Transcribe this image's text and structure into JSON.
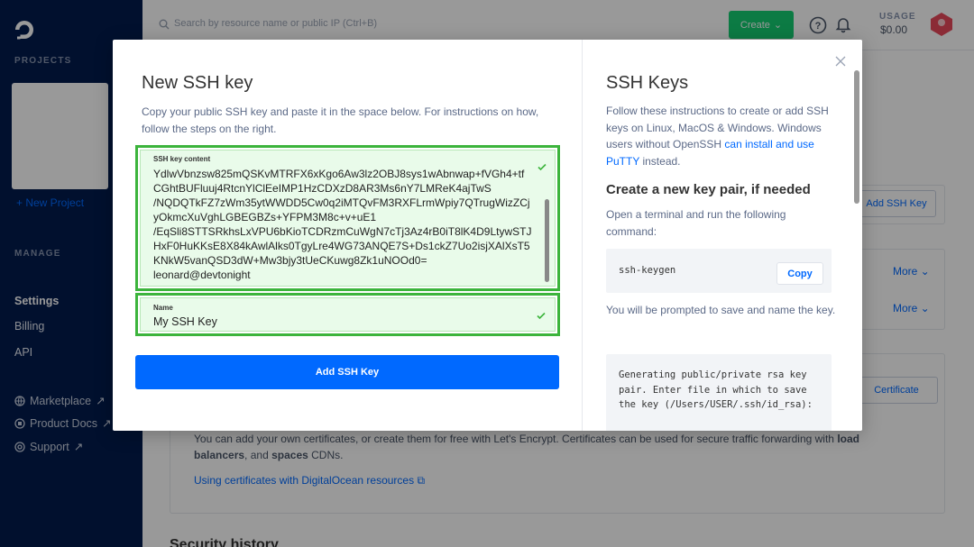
{
  "app": {
    "search_placeholder": "Search by resource name or public IP (Ctrl+B)",
    "create_label": "Create",
    "usage_label": "USAGE",
    "usage_value": "$0.00"
  },
  "sidebar": {
    "projects_label": "PROJECTS",
    "new_project_label": "New Project",
    "manage_label": "MANAGE",
    "items": [
      {
        "label": "Settings"
      },
      {
        "label": "Billing"
      },
      {
        "label": "API"
      }
    ],
    "external": [
      {
        "label": "Marketplace"
      },
      {
        "label": "Product Docs"
      },
      {
        "label": "Support"
      }
    ]
  },
  "background": {
    "add_ssh_key_label": "Add SSH Key",
    "more_label_1": "More",
    "more_label_2": "More",
    "certificate_label": "Certificate",
    "cert_text_1": "You can add your own certificates, or create them for free with Let's Encrypt. Certificates can be used for secure traffic forwarding with",
    "cert_text_bold_1": "load balancers",
    "cert_text_2": ", and",
    "cert_text_bold_2": "spaces",
    "cert_text_3": "CDNs.",
    "cert_link": "Using certificates with DigitalOcean resources",
    "security_heading": "Security history"
  },
  "modal": {
    "title": "New SSH key",
    "description": "Copy your public SSH key and paste it in the space below. For instructions on how, follow the steps on the right.",
    "ssh_field": {
      "label": "SSH key content",
      "value": "YdlwVbnzsw825mQSKvMTRFX6xKgo6Aw3lz2OBJ8sys1wAbnwap+fVGh4+tf\nCGhtBUFluuj4RtcnYlClEeIMP1HzCDXzD8AR3Ms6nY7LMReK4ajTwS\n/NQDQTkFZ7zWm35ytWWDD5Cw0q2iMTQvFM3RXFLrmWpiy7QTrugWizZCj\nyOkmcXuVghLGBEGBZs+YFPM3M8c+v+uE1\n/EqSli8STTSRkhsLxVPU6bKioTCDRzmCuWgN7cTj3Az4rB0iT8lK4D9LtywSTJ\nHxF0HuKKsE8X84kAwlAlks0TgyLre4WG73ANQE7S+Ds1ckZ7Uo2isjXAlXsT5\nKNkW5vanQSD3dW+Mw3bjy3tUeCKuwg8Zk1uNOOd0=\nleonard@devtonight"
    },
    "name_field": {
      "label": "Name",
      "value": "My SSH Key"
    },
    "submit_label": "Add SSH Key"
  },
  "help": {
    "title": "SSH Keys",
    "intro_1": "Follow these instructions to create or add SSH keys on Linux, MacOS & Windows. Windows users without OpenSSH",
    "intro_link": "can install and use PuTTY",
    "intro_2": "instead.",
    "heading": "Create a new key pair, if needed",
    "step_text": "Open a terminal and run the following command:",
    "command": "ssh-keygen",
    "copy_label": "Copy",
    "prompt_text": "You will be prompted to save and name the key.",
    "output": "Generating public/private rsa key pair. Enter file in which to save the key (/Users/USER/.ssh/id_rsa):"
  },
  "colors": {
    "brand_blue": "#0069ff",
    "success_green": "#3cb43c",
    "create_green": "#15cd72",
    "sidebar_navy": "#031b4e"
  }
}
